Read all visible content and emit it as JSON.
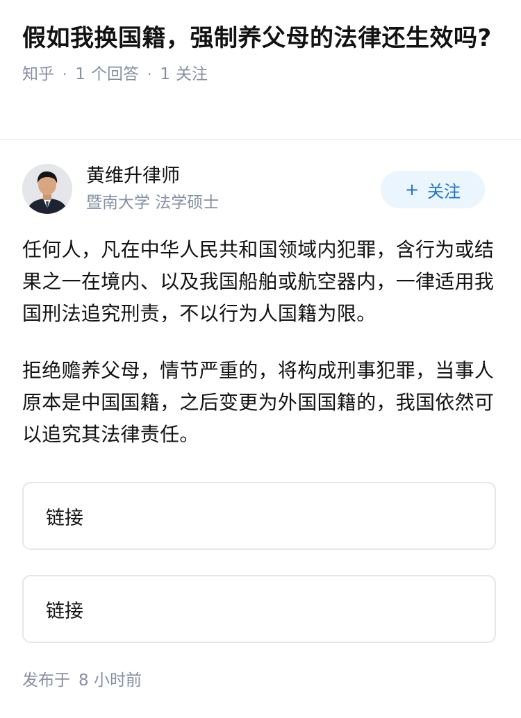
{
  "question": {
    "title": "假如我换国籍，强制养父母的法律还生效吗?",
    "source": "知乎",
    "answer_count": "1",
    "answer_label": "个回答",
    "follower_count": "1",
    "follower_label": "关注"
  },
  "author": {
    "name": "黄维升律师",
    "description": "暨南大学 法学硕士",
    "follow_label": "关注",
    "follow_icon": "plus-icon"
  },
  "answer": {
    "paragraphs": [
      "任何人，凡在中华人民共和国领域内犯罪，含行为或结果之一在境内、以及我国船舶或航空器内，一律适用我国刑法追究刑责，不以行为人国籍为限。",
      "拒绝赡养父母，情节严重的，将构成刑事犯罪，当事人原本是中国国籍，之后变更为外国国籍的，我国依然可以追究其法律责任。"
    ],
    "links": [
      "链接",
      "链接"
    ],
    "publish_prefix": "发布于",
    "publish_time": "8 小时前"
  },
  "colors": {
    "text": "#121212",
    "secondary": "#8590a6",
    "accent": "#1772d8",
    "follow_bg": "#ebf5fd"
  }
}
